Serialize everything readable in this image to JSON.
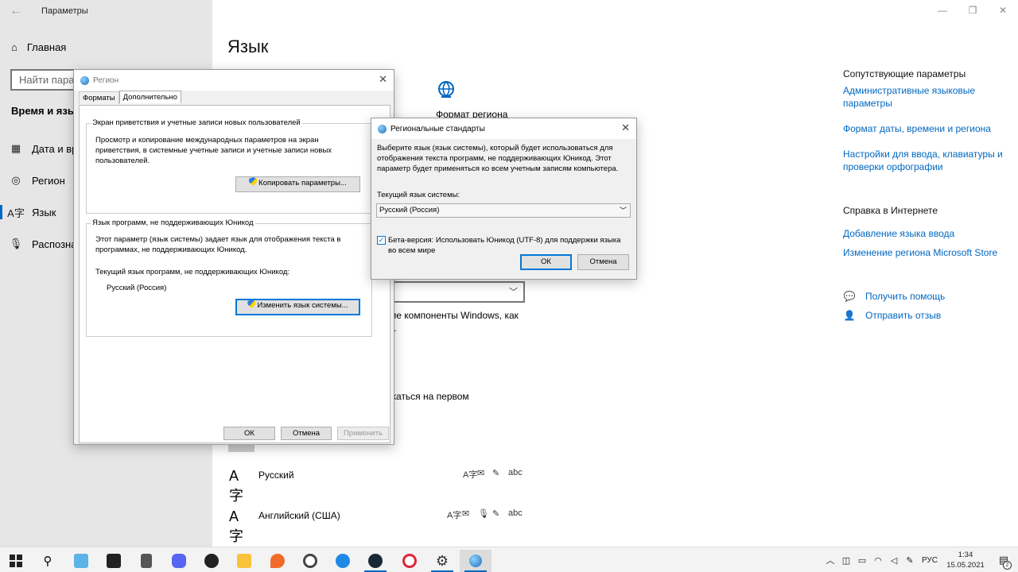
{
  "settings": {
    "app_title": "Параметры",
    "back_glyph": "←",
    "controls": {
      "minimize": "—",
      "maximize": "❐",
      "close": "✕"
    },
    "nav_home": "Главная",
    "search_placeholder": "Найти парам",
    "section_title": "Время и язык",
    "nav": [
      {
        "label": "Дата и вр",
        "icon": "▦"
      },
      {
        "label": "Регион",
        "icon": "◎"
      },
      {
        "label": "Язык",
        "icon": "A字"
      },
      {
        "label": "Распознав",
        "icon": "🎙"
      }
    ],
    "page_title": "Язык",
    "region_format_label": "Формат региона",
    "bg_text1_a": "ме компоненты Windows, как",
    "bg_text1_b": "к.",
    "bg_text2": "жаться на первом",
    "languages": [
      {
        "name": "Русский"
      },
      {
        "name": "Английский (США)"
      }
    ],
    "right": {
      "related_title": "Сопутствующие параметры",
      "link1": "Административные языковые параметры",
      "link2": "Формат даты, времени и региона",
      "link3": "Настройки для ввода, клавиатуры и проверки орфографии",
      "help_title": "Справка в Интернете",
      "link4": "Добавление языка ввода",
      "link5": "Изменение региона Microsoft Store",
      "help": "Получить помощь",
      "feedback": "Отправить отзыв"
    }
  },
  "region_dialog": {
    "title": "Регион",
    "close": "✕",
    "tabs": [
      "Форматы",
      "Дополнительно"
    ],
    "group1": {
      "legend": "Экран приветствия и учетные записи новых пользователей",
      "text": "Просмотр и копирование международных параметров на экран приветствия, в системные учетные записи и учетные записи новых пользователей.",
      "button": "Копировать параметры..."
    },
    "group2": {
      "legend": "Язык программ, не поддерживающих Юникод",
      "text": "Этот параметр (язык системы) задает язык для отображения текста в программах, не поддерживающих Юникод.",
      "current_label": "Текущий язык программ, не поддерживающих Юникод:",
      "current_value": "Русский (Россия)",
      "button": "Изменить язык системы..."
    },
    "ok": "ОК",
    "cancel": "Отмена",
    "apply": "Применить"
  },
  "regional_dialog": {
    "title": "Региональные стандарты",
    "close": "✕",
    "description": "Выберите язык (язык системы), который будет использоваться для отображения текста программ, не поддерживающих Юникод. Этот параметр будет применяться ко всем учетным записям компьютера.",
    "current_label": "Текущий язык системы:",
    "select_value": "Русский (Россия)",
    "checkbox_label": "Бета-версия: Использовать Юникод (UTF-8) для поддержки языка во всем мире",
    "checkbox_checked": true,
    "ok": "ОК",
    "cancel": "Отмена"
  },
  "taskbar": {
    "tray_lang": "РУС",
    "time": "1:34",
    "date": "15.05.2021",
    "notifications": "2"
  }
}
